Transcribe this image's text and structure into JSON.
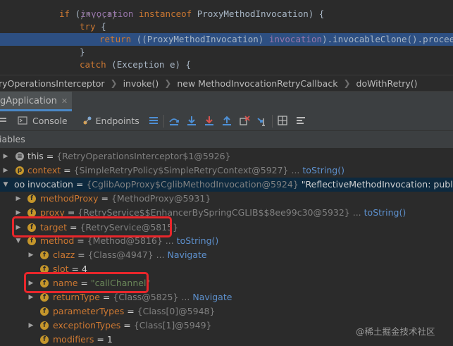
{
  "editor": {
    "line1": "/*...*/",
    "line2": {
      "kw1": "if",
      "p1": " (",
      "field": "invocation",
      "kw2": " instanceof",
      "rest": " ProxyMethodInvocation) {"
    },
    "line3": {
      "kw": "try",
      "rest": " {"
    },
    "line4": {
      "kw": "return",
      "p1": " ((ProxyMethodInvocation) ",
      "field": "invocation",
      "rest": ").invocableClone().proceed();"
    },
    "line5": "}",
    "line6": {
      "kw": "catch",
      "rest": " (Exception e) {"
    }
  },
  "breadcrumb": [
    "ryOperationsInterceptor",
    "invoke()",
    "new MethodInvocationRetryCallback",
    "doWithRetry()"
  ],
  "run_tab": {
    "label": "gApplication"
  },
  "toolbar": {
    "console": "Console",
    "endpoints": "Endpoints"
  },
  "variables_title": "iables",
  "variables": [
    {
      "name": "this",
      "eq": " = ",
      "type": "{RetryOperationsInterceptor$1@5926}",
      "extra": ""
    },
    {
      "name": "context",
      "eq": " = ",
      "type": "{SimpleRetryPolicy$SimpleRetryContext@5927}",
      "dots": " ... ",
      "link": "toString()"
    },
    {
      "name": "invocation",
      "eq": " = ",
      "type": "{CglibAopProxy$CglibMethodInvocation@5924}",
      "str": " \"ReflectiveMethodInvocation: public void c"
    },
    {
      "name": "methodProxy",
      "eq": " = ",
      "type": "{MethodProxy@5931}"
    },
    {
      "name": "proxy",
      "eq": " = ",
      "type": "{RetryService$$EnhancerBySpringCGLIB$$8ee99c30@5932}",
      "dots": " ... ",
      "link": "toString()"
    },
    {
      "name": "target",
      "eq": " = ",
      "type": "{RetryService@5815}"
    },
    {
      "name": "method",
      "eq": " = ",
      "type": "{Method@5816}",
      "dots": " ... ",
      "link": "toString()"
    },
    {
      "name": "clazz",
      "eq": " = ",
      "type": "{Class@4947}",
      "dots": " ... ",
      "link": "Navigate"
    },
    {
      "name": "slot",
      "eq": " = ",
      "num": "4"
    },
    {
      "name": "name",
      "eq": " = ",
      "str": "\"callChannel\""
    },
    {
      "name": "returnType",
      "eq": " = ",
      "type": "{Class@5825}",
      "dots": " ... ",
      "link": "Navigate"
    },
    {
      "name": "parameterTypes",
      "eq": " = ",
      "type": "{Class[0]@5948}"
    },
    {
      "name": "exceptionTypes",
      "eq": " = ",
      "type": "{Class[1]@5949}"
    },
    {
      "name": "modifiers",
      "eq": " = ",
      "num": "1"
    }
  ],
  "watermark": "@稀土掘金技术社区",
  "colors": {
    "highlight_line": "#2d4f82",
    "selected_row": "#0d293e",
    "annotation": "#e8262b"
  }
}
